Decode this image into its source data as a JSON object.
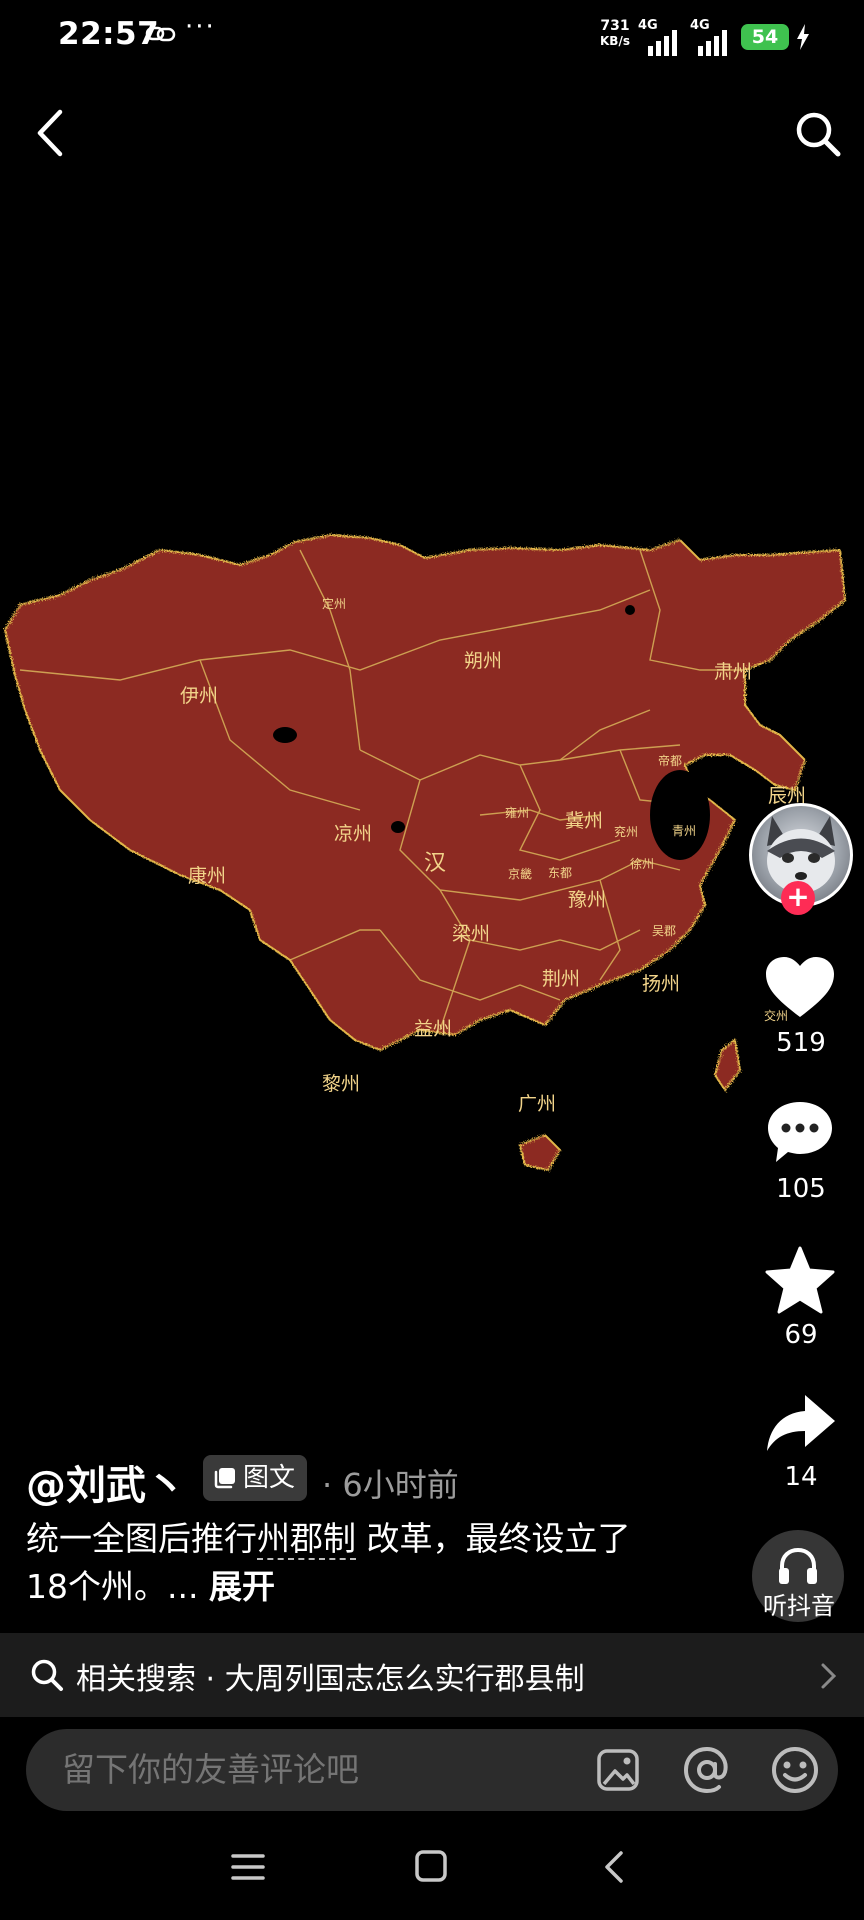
{
  "status_bar": {
    "time": "22:57",
    "net_speed_value": "731",
    "net_speed_unit": "KB/s",
    "signal1_label": "4G",
    "signal2_label": "4G",
    "battery": "54"
  },
  "map": {
    "provinces": [
      "伊州",
      "朔州",
      "肃州",
      "康州",
      "凉州",
      "汉",
      "雍州",
      "冀州",
      "兖州",
      "徐州",
      "京畿",
      "东都",
      "豫州",
      "梁州",
      "荆州",
      "扬州",
      "益州",
      "黎州",
      "广州",
      "交州",
      "帝都",
      "辰州",
      "吴郡",
      "青州",
      "定州"
    ]
  },
  "actions": {
    "likes": "519",
    "comments": "105",
    "favorites": "69",
    "shares": "14",
    "listen_label": "听抖音"
  },
  "post": {
    "author": "@刘武丶",
    "type_tag": "图文",
    "separator": "·",
    "time_ago": "6小时前",
    "caption_before": "统一全图后推行",
    "caption_highlight": "州郡制",
    "caption_after": " 改革，最终设立了18个州。... ",
    "expand_label": "展开"
  },
  "related": {
    "prefix": "相关搜索 · ",
    "query": "大周列国志怎么实行郡县制"
  },
  "comment_input": {
    "placeholder": "留下你的友善评论吧"
  },
  "colors": {
    "map_fill": "#8c2a22",
    "map_border": "#e2b64a",
    "like": "#ffffff",
    "follow": "#fe2c55",
    "battery": "#3fc24f"
  }
}
